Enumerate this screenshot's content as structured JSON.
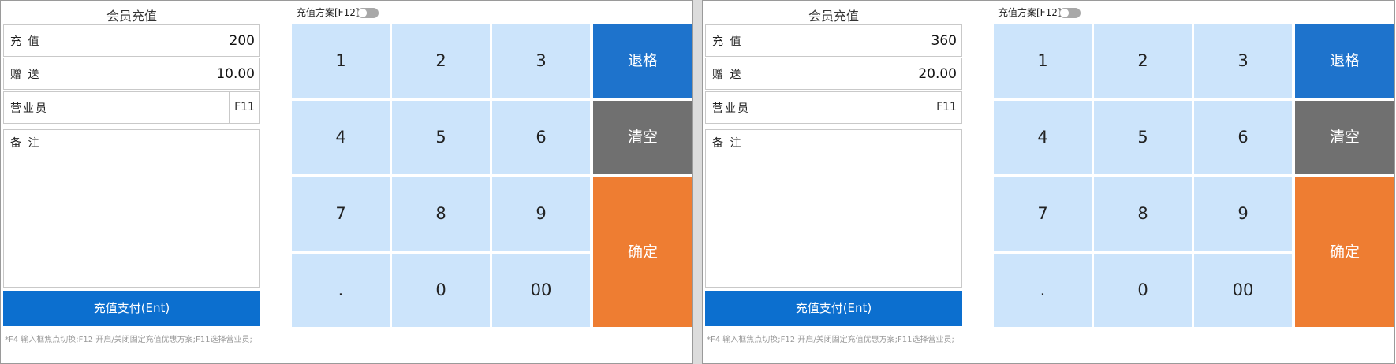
{
  "colors": {
    "key_bg": "#cce4fb",
    "backspace": "#1e73cc",
    "clear": "#707070",
    "confirm": "#ee7d32",
    "pay_button": "#0c6fcf"
  },
  "icons": {
    "scheme_toggle": "toggle-switch-icon"
  },
  "panels": [
    {
      "title": "会员充值",
      "recharge": {
        "label": "充 值",
        "value": "200"
      },
      "gift": {
        "label": "赠 送",
        "value": "10.00"
      },
      "employee": {
        "label": "营业员",
        "key": "F11"
      },
      "remark": {
        "label": "备 注"
      },
      "pay_button": "充值支付(Ent)",
      "hint": "*F4 输入框焦点切换;F12 开启/关闭固定充值优惠方案;F11选择营业员;",
      "scheme": {
        "label": "充值方案[F12]",
        "enabled": false
      },
      "keypad": [
        "1",
        "2",
        "3",
        "4",
        "5",
        "6",
        "7",
        "8",
        "9",
        ".",
        "0",
        "00"
      ],
      "actions": {
        "backspace": "退格",
        "clear": "清空",
        "confirm": "确定"
      }
    },
    {
      "title": "会员充值",
      "recharge": {
        "label": "充 值",
        "value": "360"
      },
      "gift": {
        "label": "赠 送",
        "value": "20.00"
      },
      "employee": {
        "label": "营业员",
        "key": "F11"
      },
      "remark": {
        "label": "备 注"
      },
      "pay_button": "充值支付(Ent)",
      "hint": "*F4 输入框焦点切换;F12 开启/关闭固定充值优惠方案;F11选择营业员;",
      "scheme": {
        "label": "充值方案[F12]",
        "enabled": false
      },
      "keypad": [
        "1",
        "2",
        "3",
        "4",
        "5",
        "6",
        "7",
        "8",
        "9",
        ".",
        "0",
        "00"
      ],
      "actions": {
        "backspace": "退格",
        "clear": "清空",
        "confirm": "确定"
      }
    }
  ]
}
